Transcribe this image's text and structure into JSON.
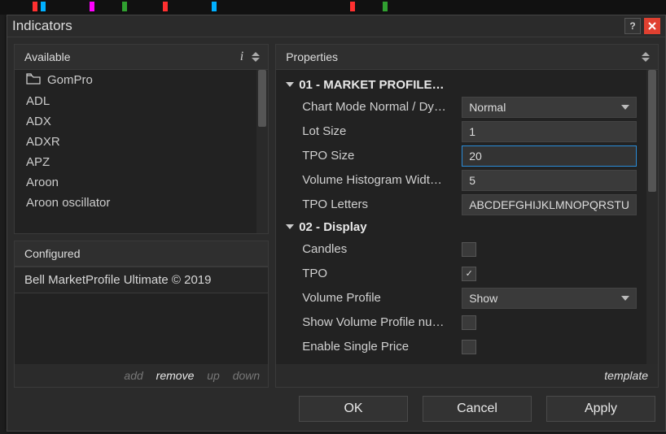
{
  "window": {
    "title": "Indicators"
  },
  "available": {
    "title": "Available",
    "items": [
      "GomPro",
      "ADL",
      "ADX",
      "ADXR",
      "APZ",
      "Aroon",
      "Aroon oscillator"
    ]
  },
  "configured": {
    "title": "Configured",
    "items": [
      "Bell MarketProfile Ultimate © 2019"
    ],
    "actions": {
      "add": "add",
      "remove": "remove",
      "up": "up",
      "down": "down"
    }
  },
  "properties": {
    "title": "Properties",
    "template_label": "template",
    "groups": [
      {
        "name": "01 - MARKET PROFILE…",
        "rows": [
          {
            "label": "Chart Mode Normal / Dy…",
            "type": "select",
            "value": "Normal"
          },
          {
            "label": "Lot Size",
            "type": "text",
            "value": "1"
          },
          {
            "label": "TPO Size",
            "type": "text",
            "value": "20",
            "active": true
          },
          {
            "label": "Volume Histogram Widt…",
            "type": "text",
            "value": "5"
          },
          {
            "label": "TPO Letters",
            "type": "text",
            "value": "ABCDEFGHIJKLMNOPQRSTU"
          }
        ]
      },
      {
        "name": "02 - Display",
        "rows": [
          {
            "label": "Candles",
            "type": "checkbox",
            "value": false
          },
          {
            "label": "TPO",
            "type": "checkbox",
            "value": true
          },
          {
            "label": "Volume Profile",
            "type": "select",
            "value": "Show"
          },
          {
            "label": "Show Volume Profile nu…",
            "type": "checkbox",
            "value": false
          },
          {
            "label": "Enable Single Price",
            "type": "checkbox",
            "value": false
          }
        ]
      }
    ]
  },
  "buttons": {
    "ok": "OK",
    "cancel": "Cancel",
    "apply": "Apply"
  }
}
